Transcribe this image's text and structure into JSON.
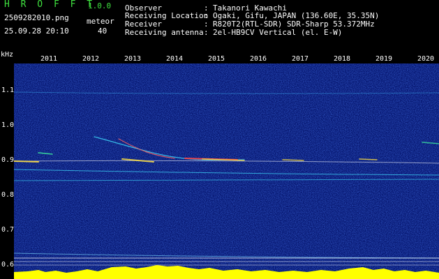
{
  "app": {
    "title": "H R O F F T",
    "version": "1.0.0",
    "filename": "2509282010.png",
    "datetime": "25.09.28 20:10",
    "meteor_label": "meteor",
    "meteor_count": "40"
  },
  "info": [
    {
      "label": "Observer",
      "value": "Takanori Kawachi"
    },
    {
      "label": "Receiving Location",
      "value": "Ogaki, Gifu, JAPAN (136.60E, 35.35N)"
    },
    {
      "label": "Receiver",
      "value": "R820T2(RTL-SDR) SDR-Sharp 53.372MHz"
    },
    {
      "label": "Receiving antenna",
      "value": "2el-HB9CV Vertical (el. E-W)"
    }
  ],
  "colon": ":",
  "axis": {
    "unit": "kHz",
    "y_ticks": [
      "1.1",
      "1.0",
      "0.9",
      "0.8",
      "0.7",
      "0.6"
    ],
    "x_ticks": [
      "2011",
      "2012",
      "2013",
      "2014",
      "2015",
      "2016",
      "2017",
      "2018",
      "2019",
      "2020"
    ]
  },
  "colors": {
    "background": "#000000",
    "spectrogram_noise": "#0a1a8c",
    "text_green": "#3fe03f",
    "meteor_trace": "#ff4040",
    "floor_yellow": "#ffff00",
    "floor_cyan": "#00e0ff"
  }
}
